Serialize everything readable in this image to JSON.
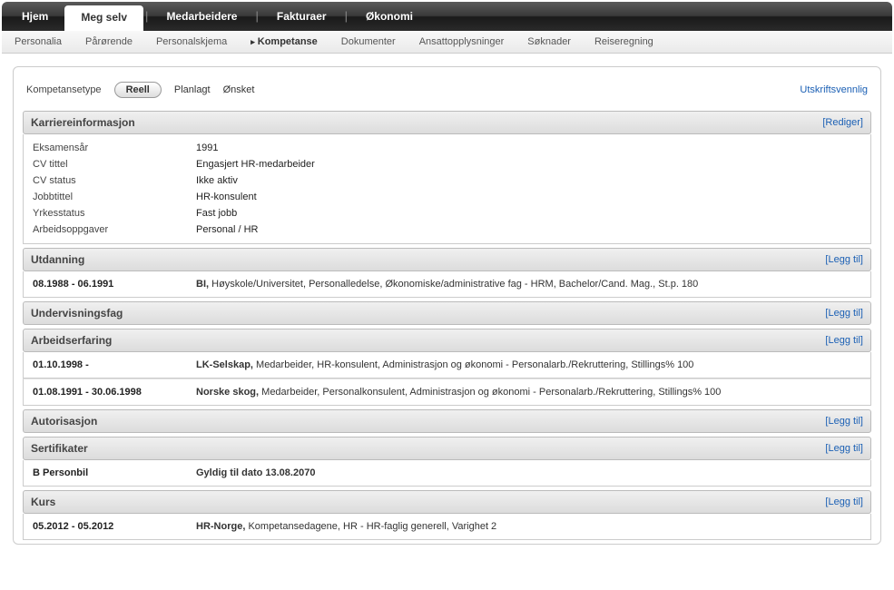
{
  "topnav": {
    "tabs": [
      {
        "label": "Hjem"
      },
      {
        "label": "Meg selv"
      },
      {
        "label": "Medarbeidere"
      },
      {
        "label": "Fakturaer"
      },
      {
        "label": "Økonomi"
      }
    ]
  },
  "subnav": {
    "items": [
      {
        "label": "Personalia"
      },
      {
        "label": "Pårørende"
      },
      {
        "label": "Personalskjema"
      },
      {
        "label": "Kompetanse"
      },
      {
        "label": "Dokumenter"
      },
      {
        "label": "Ansattopplysninger"
      },
      {
        "label": "Søknader"
      },
      {
        "label": "Reiseregning"
      }
    ]
  },
  "filter": {
    "label": "Kompetansetype",
    "options": [
      "Reell",
      "Planlagt",
      "Ønsket"
    ],
    "print": "Utskriftsvennlig"
  },
  "sections": {
    "career": {
      "title": "Karriereinformasjon",
      "action": "[Rediger]",
      "rows": [
        {
          "label": "Eksamensår",
          "value": "1991"
        },
        {
          "label": "CV tittel",
          "value": "Engasjert HR-medarbeider"
        },
        {
          "label": "CV status",
          "value": "Ikke aktiv"
        },
        {
          "label": "Jobbtittel",
          "value": "HR-konsulent"
        },
        {
          "label": "Yrkesstatus",
          "value": "Fast jobb"
        },
        {
          "label": "Arbeidsoppgaver",
          "value": "Personal / HR"
        }
      ]
    },
    "education": {
      "title": "Utdanning",
      "action": "[Legg til]",
      "rows": [
        {
          "date": "08.1988 - 06.1991",
          "lead": "BI,",
          "rest": " Høyskole/Universitet, Personalledelse, Økonomiske/administrative fag - HRM, Bachelor/Cand. Mag., St.p. 180"
        }
      ]
    },
    "teaching": {
      "title": "Undervisningsfag",
      "action": "[Legg til]"
    },
    "work": {
      "title": "Arbeidserfaring",
      "action": "[Legg til]",
      "rows": [
        {
          "date": "01.10.1998 -",
          "lead": "LK-Selskap,",
          "rest": " Medarbeider, HR-konsulent, Administrasjon og økonomi - Personalarb./Rekruttering, Stillings% 100"
        },
        {
          "date": "01.08.1991 - 30.06.1998",
          "lead": "Norske skog,",
          "rest": " Medarbeider, Personalkonsulent, Administrasjon og økonomi - Personalarb./Rekruttering, Stillings% 100"
        }
      ]
    },
    "auth": {
      "title": "Autorisasjon",
      "action": "[Legg til]"
    },
    "cert": {
      "title": "Sertifikater",
      "action": "[Legg til]",
      "rows": [
        {
          "date": "B Personbil",
          "lead": "Gyldig til dato 13.08.2070",
          "rest": ""
        }
      ]
    },
    "course": {
      "title": "Kurs",
      "action": "[Legg til]",
      "rows": [
        {
          "date": "05.2012 - 05.2012",
          "lead": "HR-Norge,",
          "rest": " Kompetansedagene, HR - HR-faglig generell, Varighet 2"
        }
      ]
    }
  }
}
